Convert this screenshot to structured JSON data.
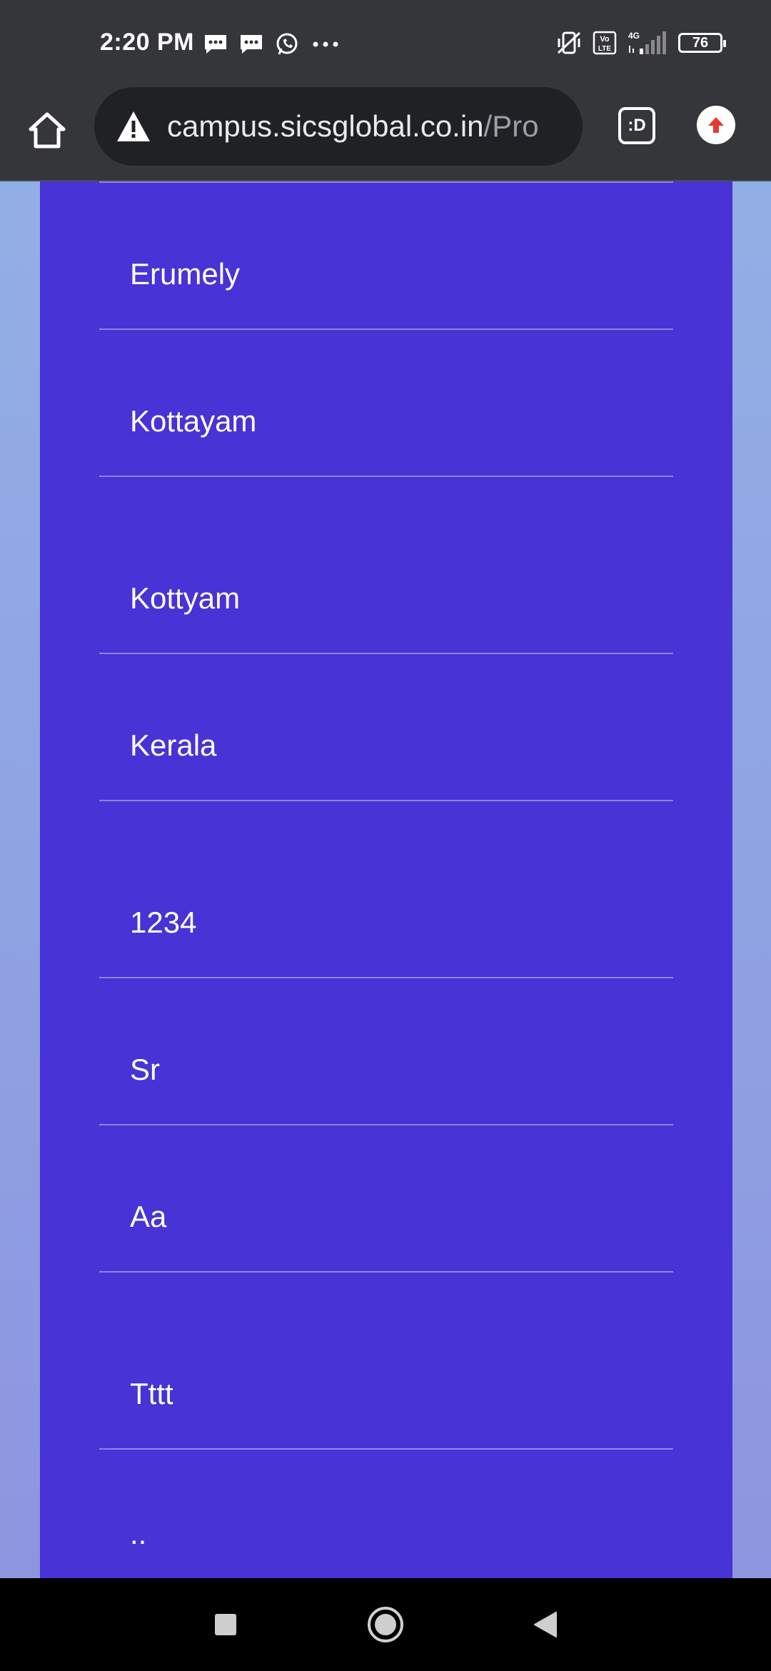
{
  "status_bar": {
    "time": "2:20 PM",
    "left_icons": [
      "message-icon",
      "message-icon",
      "whatsapp-icon",
      "more-dots-icon"
    ],
    "right_icons": [
      "vibrate-off-icon",
      "volte-icon",
      "signal-4g-icon",
      "battery-icon"
    ],
    "battery_level": "76",
    "network": "4G"
  },
  "browser": {
    "url_host": "campus.sicsglobal.co.in",
    "url_path": "/Pro",
    "tabs_label": ":D"
  },
  "form": {
    "fields": [
      {
        "value": "Erumely"
      },
      {
        "value": "Kottayam"
      },
      {
        "value": "Kottyam"
      },
      {
        "value": "Kerala"
      },
      {
        "value": "1234"
      },
      {
        "value": "Sr"
      },
      {
        "value": "Aa"
      },
      {
        "value": "Tttt"
      },
      {
        "value": ".."
      }
    ]
  },
  "colors": {
    "status_bar": "#35363a",
    "card": "#4733d6",
    "divider": "#8f85e8",
    "page_bg": "#93b2e6"
  }
}
